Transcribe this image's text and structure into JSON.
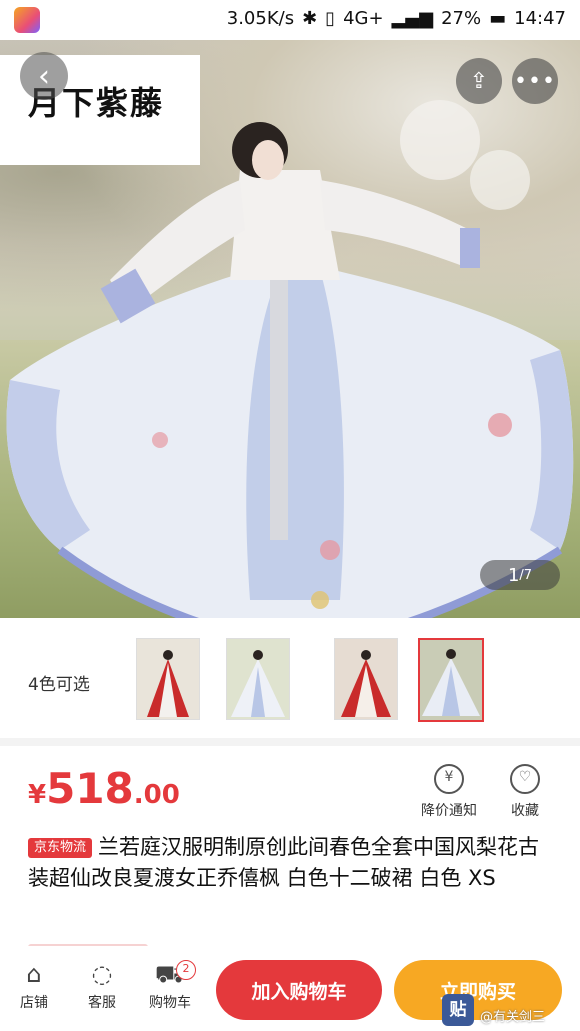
{
  "status_bar": {
    "network_speed": "3.05K/s",
    "network": "4G+",
    "battery": "27%",
    "time": "14:47"
  },
  "gallery": {
    "brand_text": "月下紫藤",
    "page_current": "1",
    "page_total": "/7"
  },
  "colors": {
    "label": "4色可选",
    "thumbnails": [
      "red-white",
      "white-blue",
      "red-white-2",
      "blue-selected"
    ]
  },
  "price": {
    "currency": "¥",
    "integer": "518",
    "decimal": ".00"
  },
  "actions": {
    "price_alert": "降价通知",
    "favorite": "收藏"
  },
  "product": {
    "tag": "京东物流",
    "title": "兰若庭汉服明制原创此间春色全套中国风梨花古装超仙改良夏渡女正乔僖枫 白色十二破裙 白色 XS"
  },
  "bottom_nav": {
    "shop": "店铺",
    "service": "客服",
    "cart": "购物车",
    "cart_count": "2",
    "add_to_cart": "加入购物车",
    "buy_now": "立即购买"
  },
  "watermark": {
    "icon_text": "贴",
    "text": "@有关剑三"
  },
  "theme": {
    "accent": "#e4393c",
    "buy": "#f7a823"
  }
}
